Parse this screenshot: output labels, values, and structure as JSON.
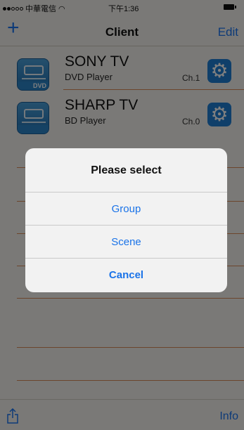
{
  "status_bar": {
    "carrier": "中華電信",
    "time": "下午1:36"
  },
  "nav": {
    "add_label": "+",
    "title": "Client",
    "edit_label": "Edit"
  },
  "devices": [
    {
      "name": "SONY TV",
      "type": "DVD Player",
      "channel": "Ch.1",
      "icon_tag": "DVD"
    },
    {
      "name": "SHARP TV",
      "type": "BD Player",
      "channel": "Ch.0",
      "icon_tag": ""
    }
  ],
  "toolbar": {
    "info_label": "Info"
  },
  "dialog": {
    "title": "Please select",
    "options": [
      "Group",
      "Scene"
    ],
    "cancel_label": "Cancel"
  },
  "colors": {
    "accent": "#1a75f0",
    "separator": "#d88a59",
    "gear": "#1e7ed4"
  },
  "icons": [
    "wifi-icon",
    "battery-icon",
    "add-icon",
    "dvd-player-icon",
    "bd-player-icon",
    "gear-icon",
    "share-icon"
  ]
}
